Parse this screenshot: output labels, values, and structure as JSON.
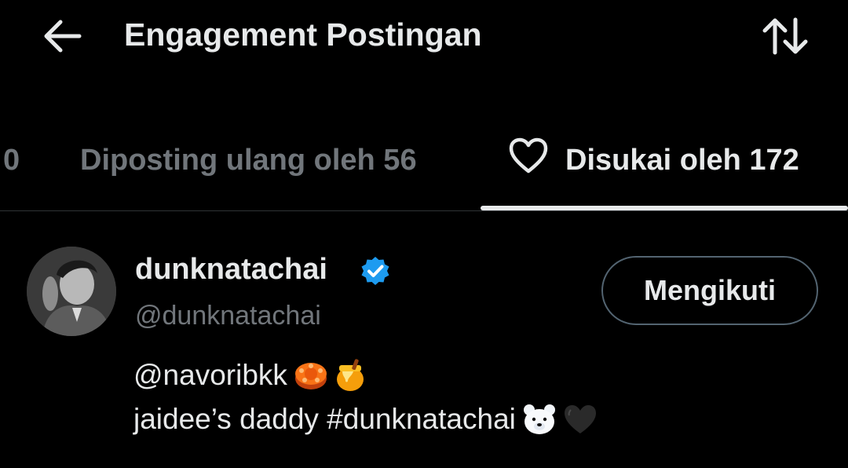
{
  "header": {
    "title": "Engagement Postingan",
    "back_icon": "arrow-left-icon",
    "sort_icon": "sort-arrows-icon"
  },
  "tabs": [
    {
      "label": "0",
      "active": false
    },
    {
      "label": "Diposting ulang oleh 56",
      "active": false
    },
    {
      "label": "Disukai oleh 172",
      "active": true,
      "icon": "heart-icon"
    }
  ],
  "user": {
    "display_name": "dunknatachai",
    "handle": "@dunknatachai",
    "verified": true,
    "follow_label": "Mengikuti",
    "bio_line1": "@navoribkk",
    "bio_line1_emojis": [
      "mooncake-emoji",
      "honey-pot-emoji"
    ],
    "bio_line2": "jaidee’s daddy #dunknatachai",
    "bio_line2_emojis": [
      "polar-bear-emoji",
      "black-heart-emoji"
    ]
  },
  "colors": {
    "background": "#000000",
    "text_primary": "#e7e9ea",
    "text_secondary": "#71767b",
    "verified_blue": "#1d9bf0",
    "divider": "#2f3336",
    "button_border": "#536471"
  }
}
